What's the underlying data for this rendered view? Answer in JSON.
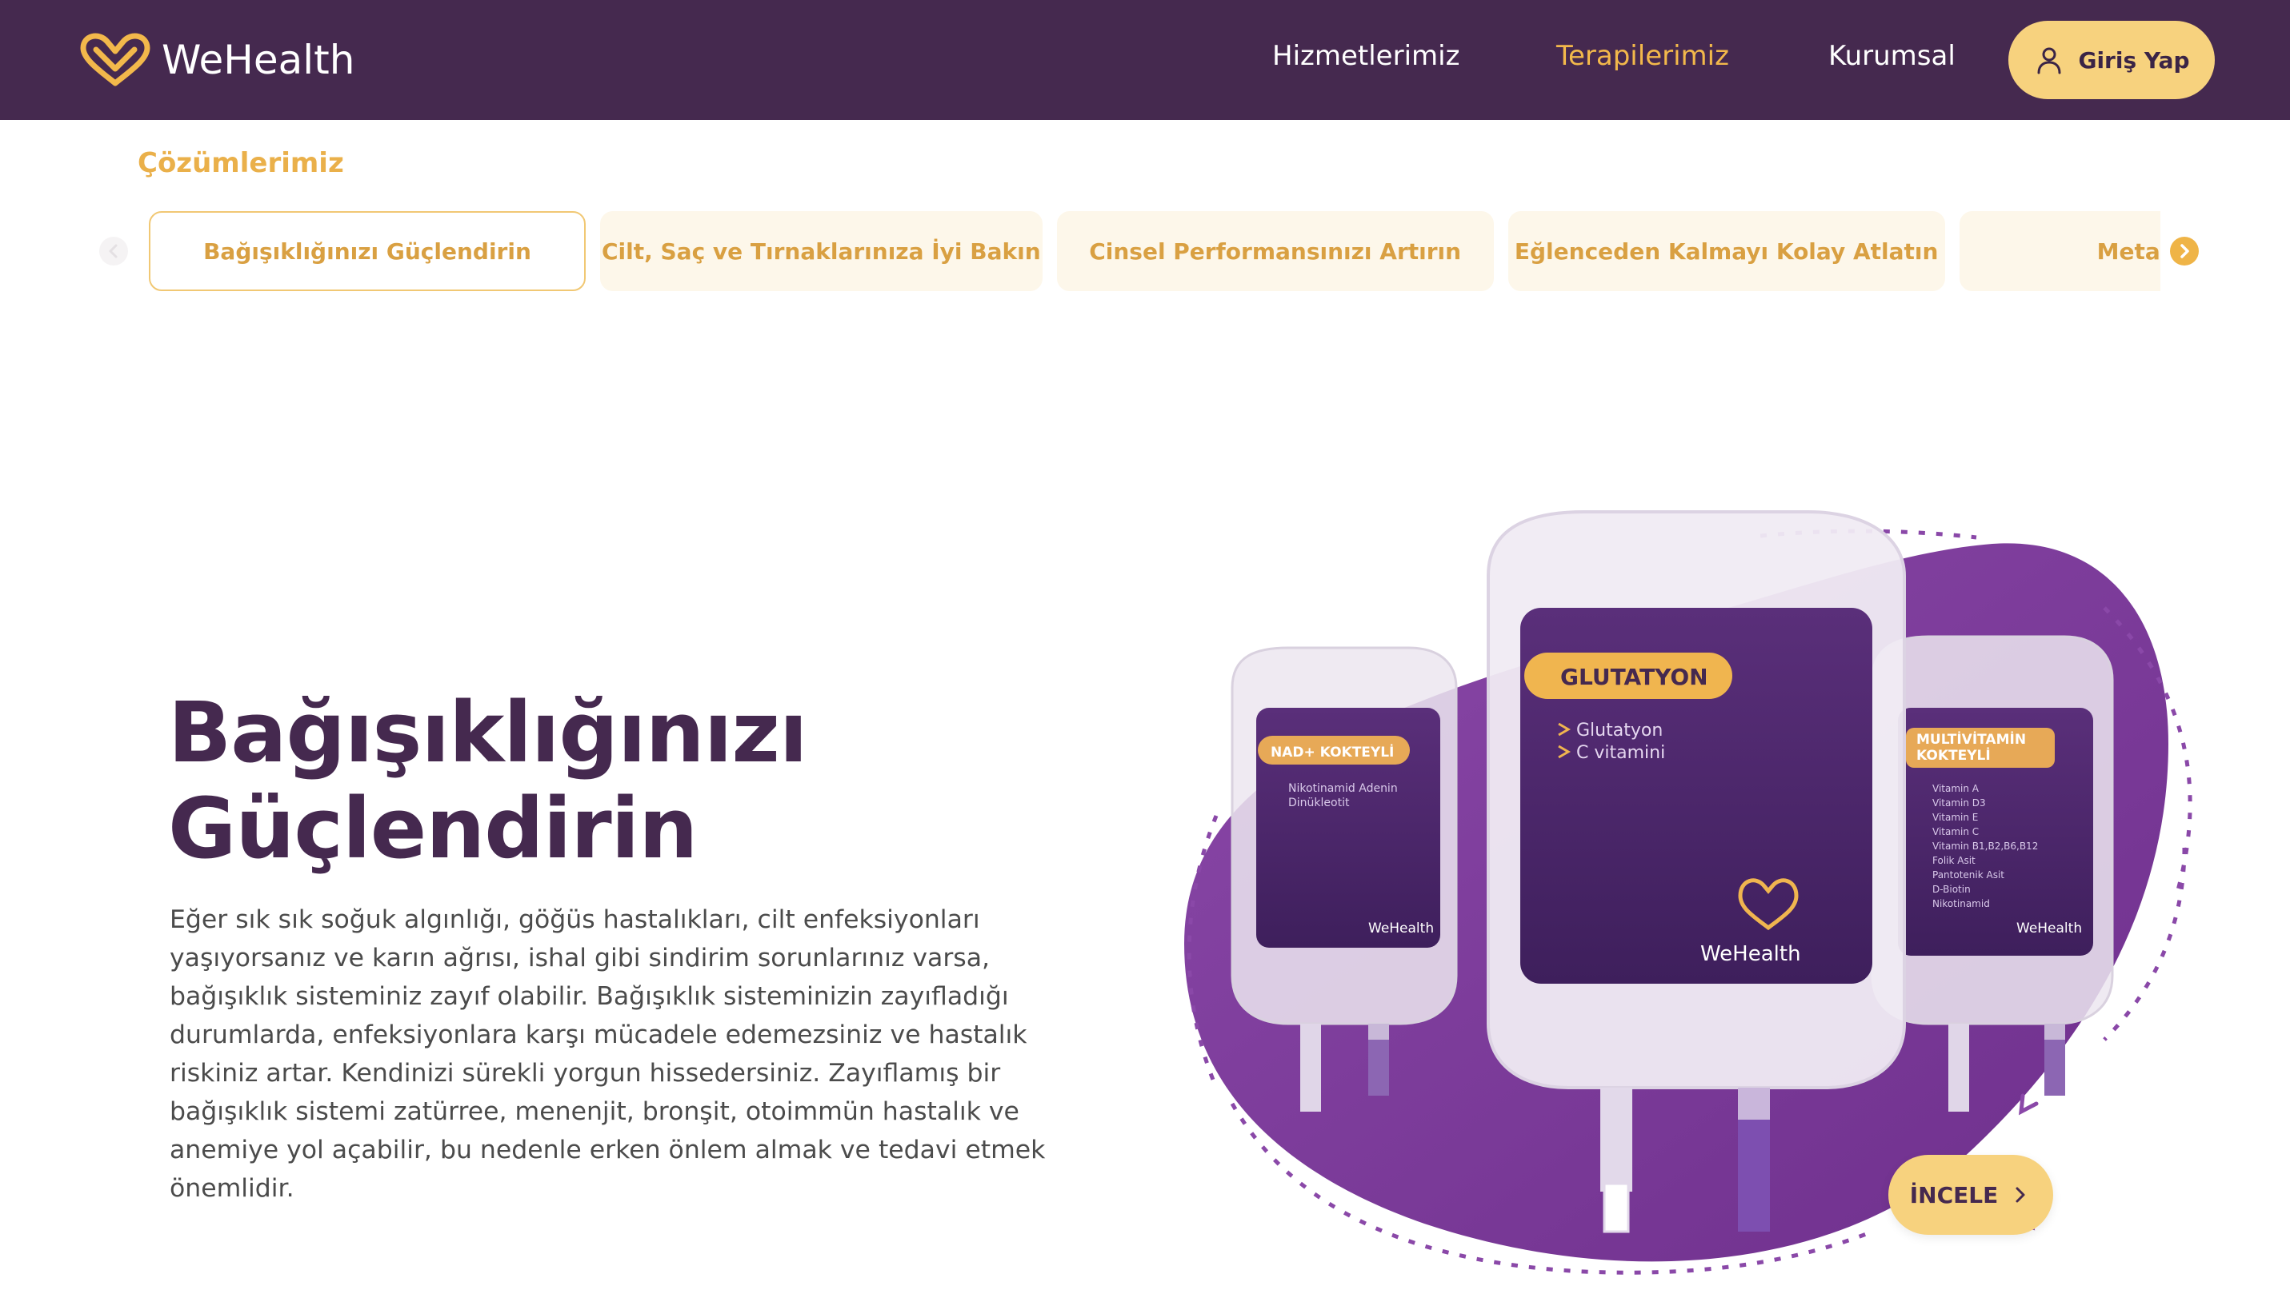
{
  "brand": {
    "name": "WeHealth",
    "accent": "#f2b84b",
    "primary": "#45294f",
    "violet": "#7d3d98"
  },
  "header": {
    "nav": [
      {
        "label": "Hizmetlerimiz",
        "active": false
      },
      {
        "label": "Terapilerimiz",
        "active": true
      },
      {
        "label": "Kurumsal",
        "active": false
      }
    ],
    "login_label": "Giriş Yap",
    "login_icon": "user-icon"
  },
  "solutions": {
    "label": "Çözümlerimiz",
    "tabs": [
      {
        "label": "Bağışıklığınızı Güçlendirin",
        "active": true
      },
      {
        "label": "Cilt, Saç ve Tırnaklarınıza İyi Bakın",
        "active": false
      },
      {
        "label": "Cinsel Performansınızı Artırın",
        "active": false
      },
      {
        "label": "Eğlenceden Kalmayı Kolay Atlatın",
        "active": false
      },
      {
        "label": "Metabolizma",
        "active": false
      }
    ],
    "prev_icon": "chevron-left-icon",
    "next_icon": "chevron-right-icon"
  },
  "hero": {
    "title_line1": "Bağışıklığınızı",
    "title_line2": "Güçlendirin",
    "description": "Eğer sık sık soğuk algınlığı, göğüs hastalıkları, cilt enfeksiyonları yaşıyorsanız ve karın ağrısı, ishal gibi sindirim sorunlarınız varsa, bağışıklık sisteminiz zayıf olabilir. Bağışıklık sisteminizin zayıfladığı durumlarda, enfeksiyonlara karşı mücadele edemezsiniz ve hastalık riskiniz artar. Kendinizi sürekli yorgun hissedersiniz. Zayıflamış bir bağışıklık sistemi zatürree, menenjit, bronşit, otoimmün hastalık ve anemiye yol açabilir, bu nedenle erken önlem almak ve tedavi etmek önemlidir.",
    "cta_label": "İNCELE"
  },
  "products": [
    {
      "name": "NAD+ KOKTEYLİ",
      "ingredients": [
        "Nikotinamid Adenin",
        "Dinükleotit"
      ],
      "brand": "WeHealth"
    },
    {
      "name": "GLUTATYON",
      "ingredients": [
        "Glutatyon",
        "C vitamini"
      ],
      "brand": "WeHealth"
    },
    {
      "name_line1": "MULTİVİTAMİN",
      "name_line2": "KOKTEYLİ",
      "ingredients": [
        "Vitamin A",
        "Vitamin D3",
        "Vitamin E",
        "Vitamin C",
        "Vitamin B1,B2,B6,B12",
        "Folik Asit",
        "Pantotenik Asit",
        "D-Biotin",
        "Nikotinamid"
      ],
      "brand": "WeHealth"
    }
  ]
}
